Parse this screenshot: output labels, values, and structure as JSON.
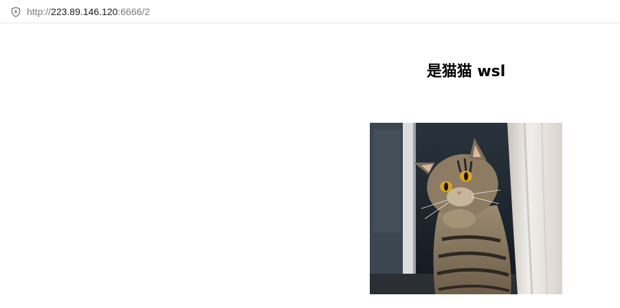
{
  "browser": {
    "url_scheme": "http://",
    "url_host": "223.89.146.120",
    "url_rest": ":6666/2",
    "shield_icon": "shield-icon"
  },
  "page": {
    "title": "是猫猫 wsl"
  },
  "image": {
    "subject": "tabby-cat-photo",
    "colors": {
      "background": "#1b232c",
      "curtain": "#e9e6e2",
      "window_frame": "#d8d8d8",
      "fur": "#8a7a62",
      "stripes": "#2e2720",
      "eyes": "#d9a521"
    }
  }
}
